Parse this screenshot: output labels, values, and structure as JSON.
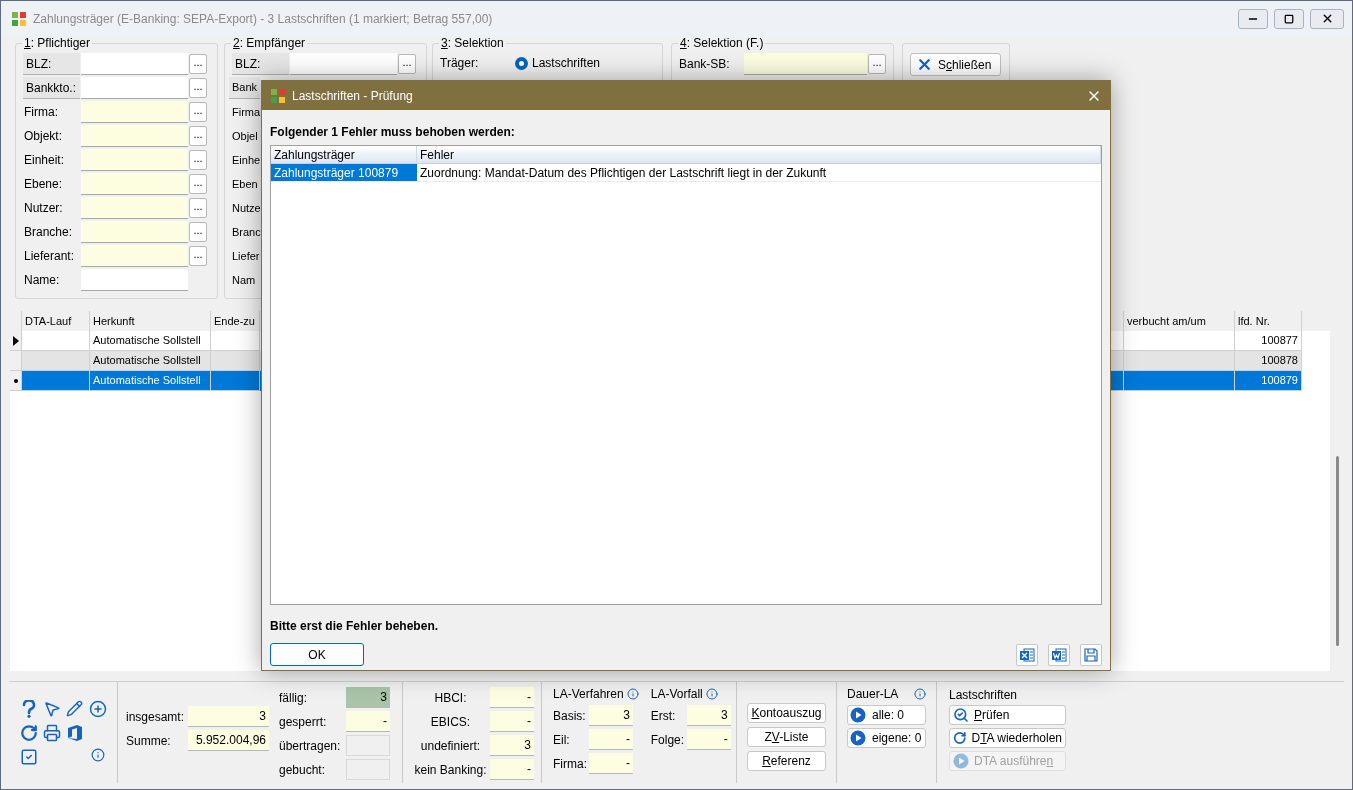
{
  "window": {
    "title": "Zahlungsträger (E-Banking: SEPA-Export) - 3 Lastschriften (1 markiert; Betrag 557,00)"
  },
  "filter_groups": [
    {
      "title": {
        "key": "1",
        "post": ": Pflichtiger"
      },
      "rows": [
        {
          "label": "BLZ:",
          "kind": "button",
          "field": {
            "highlighted": false,
            "picker": "..."
          }
        },
        {
          "label": "Bankkto.:",
          "kind": "button",
          "field": {
            "highlighted": false,
            "picker": "..."
          }
        },
        {
          "label": "Firma:",
          "kind": "text",
          "field": {
            "highlighted": true,
            "picker": "..."
          }
        },
        {
          "label": "Objekt:",
          "kind": "text",
          "field": {
            "highlighted": true,
            "picker": "..."
          }
        },
        {
          "label": "Einheit:",
          "kind": "text",
          "field": {
            "highlighted": true,
            "picker": "..."
          }
        },
        {
          "label": "Ebene:",
          "kind": "text",
          "field": {
            "highlighted": true,
            "picker": "..."
          }
        },
        {
          "label": "Nutzer:",
          "kind": "text",
          "field": {
            "highlighted": true,
            "picker": "..."
          }
        },
        {
          "label": "Branche:",
          "kind": "text",
          "field": {
            "highlighted": true,
            "picker": "..."
          }
        },
        {
          "label": "Lieferant:",
          "kind": "text",
          "field": {
            "highlighted": true,
            "picker": "..."
          }
        },
        {
          "label": "Name:",
          "kind": "text",
          "field": {
            "highlighted": false
          }
        }
      ]
    },
    {
      "title": {
        "key": "2",
        "post": ": Empfänger"
      },
      "rows": [
        {
          "label": "BLZ:",
          "kind": "button",
          "field": {
            "highlighted": false,
            "picker": "..."
          }
        },
        {
          "label": "Bank",
          "kind": "button"
        },
        {
          "label": "Firma",
          "kind": "text"
        },
        {
          "label": "Objel",
          "kind": "text"
        },
        {
          "label": "Einhe",
          "kind": "text"
        },
        {
          "label": "Eben",
          "kind": "text"
        },
        {
          "label": "Nutze",
          "kind": "text"
        },
        {
          "label": "Branc",
          "kind": "text"
        },
        {
          "label": "Liefer",
          "kind": "text"
        },
        {
          "label": "Nam",
          "kind": "text"
        }
      ]
    }
  ],
  "selection": {
    "title": {
      "key": "3",
      "post": ": Selektion"
    },
    "label": "Träger:",
    "radio": {
      "label": "Lastschriften",
      "selected": true
    }
  },
  "selection_f": {
    "title": {
      "key": "4",
      "post": ": Selektion (F.)"
    },
    "label": "Bank-SB:",
    "field": {
      "highlighted": true,
      "picker": "..."
    }
  },
  "close_button": {
    "pre": "S",
    "key": "c",
    "post": "hließen"
  },
  "grid": {
    "left_columns": [
      "DTA-Lauf",
      "Herkunft",
      "Ende-zu"
    ],
    "right_columns": [
      "verbucht am/um",
      "lfd. Nr."
    ],
    "rows": [
      {
        "kind": "arrow",
        "shaded": false,
        "selected": false,
        "herkunft": "Automatische Sollstell",
        "lfd_nr": "100877"
      },
      {
        "kind": "none",
        "shaded": true,
        "selected": false,
        "herkunft": "Automatische Sollstell",
        "lfd_nr": "100878"
      },
      {
        "kind": "dot",
        "shaded": false,
        "selected": true,
        "herkunft": "Automatische Sollstell",
        "lfd_nr": "100879"
      }
    ]
  },
  "dialog": {
    "title": "Lastschriften - Prüfung",
    "heading": "Folgender 1 Fehler muss behoben werden:",
    "columns": [
      "Zahlungsträger",
      "Fehler"
    ],
    "rows": [
      {
        "selected": true,
        "cells": [
          "Zahlungsträger 100879",
          "Zuordnung: Mandat-Datum des Pflichtigen der Lastschrift liegt in der Zukunft"
        ]
      }
    ],
    "message": "Bitte erst die Fehler beheben.",
    "ok_button": "OK"
  },
  "summary": {
    "totals": [
      {
        "label": "insgesamt:",
        "value": "3"
      },
      {
        "label": "Summe:",
        "value": "5.952.004,96"
      }
    ],
    "states": [
      {
        "label": "fällig:",
        "value": "3",
        "kind": "highlight"
      },
      {
        "label": "gesperrt:",
        "value": "-",
        "kind": "normal"
      },
      {
        "label": "übertragen:",
        "kind": "empty"
      },
      {
        "label": "gebucht:",
        "kind": "empty"
      }
    ]
  },
  "banking": [
    {
      "label": "HBCI:",
      "value": "-"
    },
    {
      "label": "EBICS:",
      "value": "-"
    },
    {
      "label": "undefiniert:",
      "value": "3"
    },
    {
      "label": "kein Banking:",
      "value": "-"
    }
  ],
  "la_verfahren": {
    "title": "LA-Verfahren",
    "rows": [
      {
        "label": "Basis:",
        "value": "3"
      },
      {
        "label": "Eil:",
        "value": "-"
      },
      {
        "label": "Firma:",
        "value": "-"
      }
    ]
  },
  "la_vorfall": {
    "title": "LA-Vorfall",
    "rows": [
      {
        "label": "Erst:",
        "value": "3"
      },
      {
        "label": "Folge:",
        "value": "-"
      }
    ]
  },
  "reports": [
    {
      "key": "K",
      "post": "ontoauszug"
    },
    {
      "pre": "Z",
      "key": "V",
      "post": "-Liste"
    },
    {
      "key": "R",
      "post": "eferenz"
    }
  ],
  "dauer_la": {
    "title": "Dauer-LA",
    "buttons": [
      "alle: 0",
      "eigene: 0"
    ]
  },
  "lastschriften": {
    "title": "Lastschriften",
    "buttons": [
      {
        "kind": "check",
        "label": {
          "key": "P",
          "post": "rüfen"
        },
        "disabled": false
      },
      {
        "kind": "repeat",
        "label": {
          "pre": "D",
          "key": "T",
          "post": "A wiederholen"
        },
        "disabled": false
      },
      {
        "kind": "play",
        "label": {
          "pre": "DTA ausführe",
          "key": "n"
        },
        "disabled": true
      }
    ]
  }
}
